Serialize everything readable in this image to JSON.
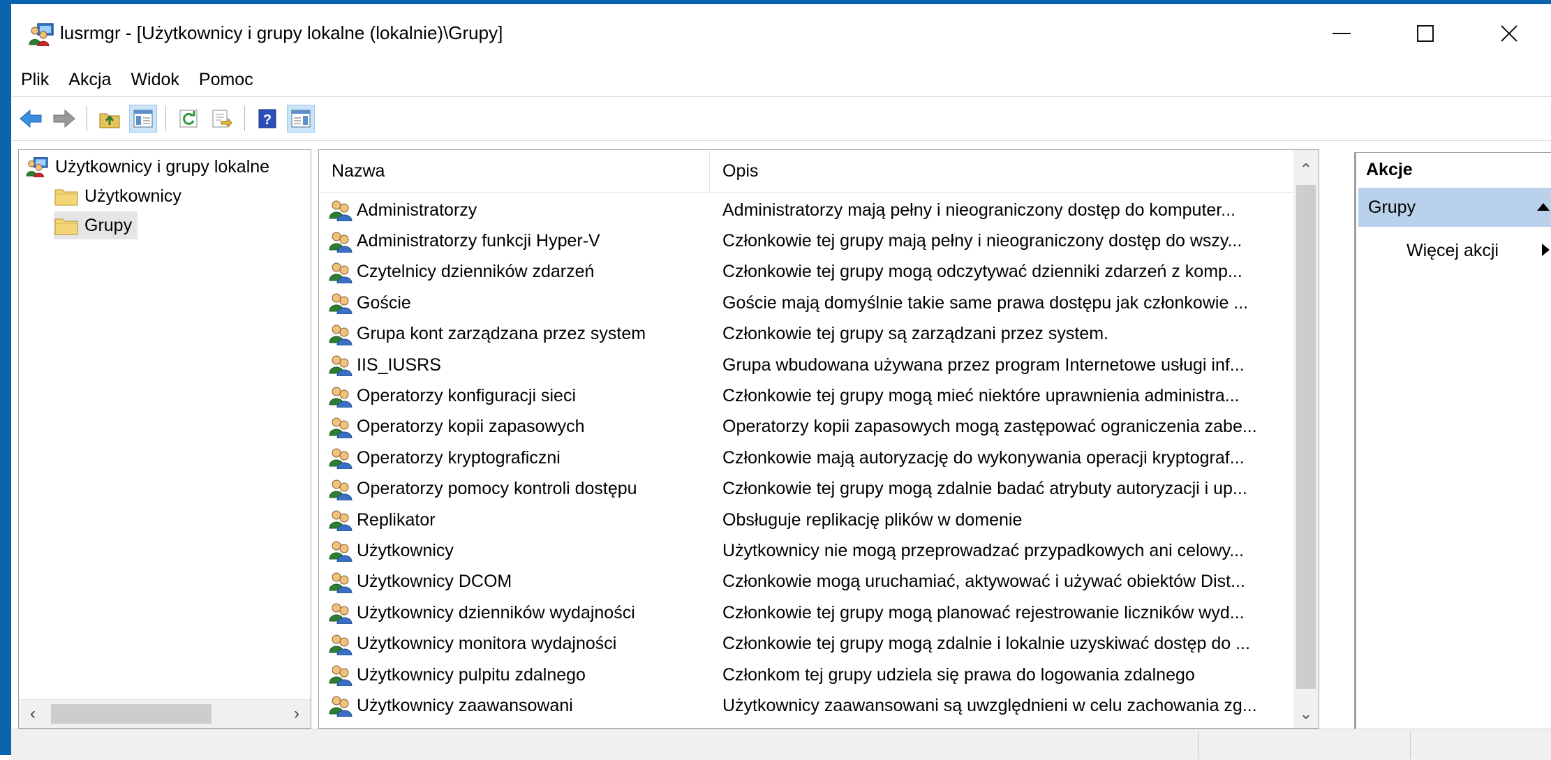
{
  "window": {
    "title": "lusrmgr - [Użytkownicy i grupy lokalne (lokalnie)\\Grupy]"
  },
  "menu": [
    "Plik",
    "Akcja",
    "Widok",
    "Pomoc"
  ],
  "toolbar": {
    "icons": [
      "back-icon",
      "forward-icon",
      "up-folder-icon",
      "show-hide-tree-icon",
      "refresh-icon",
      "export-list-icon",
      "help-icon",
      "show-hide-action-pane-icon"
    ]
  },
  "tree": {
    "root": "Użytkownicy i grupy lokalne",
    "children": [
      "Użytkownicy",
      "Grupy"
    ],
    "selected": "Grupy"
  },
  "list": {
    "columns": [
      "Nazwa",
      "Opis"
    ],
    "rows": [
      {
        "name": "Administratorzy",
        "desc": "Administratorzy mają pełny i nieograniczony dostęp do komputer..."
      },
      {
        "name": "Administratorzy funkcji Hyper-V",
        "desc": "Członkowie tej grupy mają pełny i nieograniczony dostęp do wszy..."
      },
      {
        "name": "Czytelnicy dzienników zdarzeń",
        "desc": "Członkowie tej grupy mogą odczytywać dzienniki zdarzeń z komp..."
      },
      {
        "name": "Goście",
        "desc": "Goście mają domyślnie takie same prawa dostępu jak członkowie ..."
      },
      {
        "name": "Grupa kont zarządzana przez system",
        "desc": "Członkowie tej grupy są zarządzani przez system."
      },
      {
        "name": "IIS_IUSRS",
        "desc": "Grupa wbudowana używana przez program Internetowe usługi inf..."
      },
      {
        "name": "Operatorzy konfiguracji sieci",
        "desc": "Członkowie tej grupy mogą mieć niektóre uprawnienia administra..."
      },
      {
        "name": "Operatorzy kopii zapasowych",
        "desc": "Operatorzy kopii zapasowych mogą zastępować ograniczenia zabe..."
      },
      {
        "name": "Operatorzy kryptograficzni",
        "desc": "Członkowie mają autoryzację do wykonywania operacji kryptograf..."
      },
      {
        "name": "Operatorzy pomocy kontroli dostępu",
        "desc": "Członkowie tej grupy mogą zdalnie badać atrybuty autoryzacji i up..."
      },
      {
        "name": "Replikator",
        "desc": "Obsługuje replikację plików w domenie"
      },
      {
        "name": "Użytkownicy",
        "desc": "Użytkownicy nie mogą przeprowadzać przypadkowych ani celowy..."
      },
      {
        "name": "Użytkownicy DCOM",
        "desc": "Członkowie mogą uruchamiać, aktywować i używać obiektów Dist..."
      },
      {
        "name": "Użytkownicy dzienników wydajności",
        "desc": "Członkowie tej grupy mogą planować rejestrowanie liczników wyd..."
      },
      {
        "name": "Użytkownicy monitora wydajności",
        "desc": "Członkowie tej grupy mogą zdalnie i lokalnie uzyskiwać dostęp do ..."
      },
      {
        "name": "Użytkownicy pulpitu zdalnego",
        "desc": "Członkom tej grupy udziela się prawa do logowania zdalnego"
      },
      {
        "name": "Użytkownicy zaawansowani",
        "desc": "Użytkownicy zaawansowani są uwzględnieni w celu zachowania zg..."
      }
    ]
  },
  "actions": {
    "title": "Akcje",
    "group": "Grupy",
    "more": "Więcej akcji"
  },
  "colors": {
    "window_border": "#0a64ad",
    "action_group_bg": "#b9d1ea",
    "selection_bg": "#e5e5e5"
  }
}
